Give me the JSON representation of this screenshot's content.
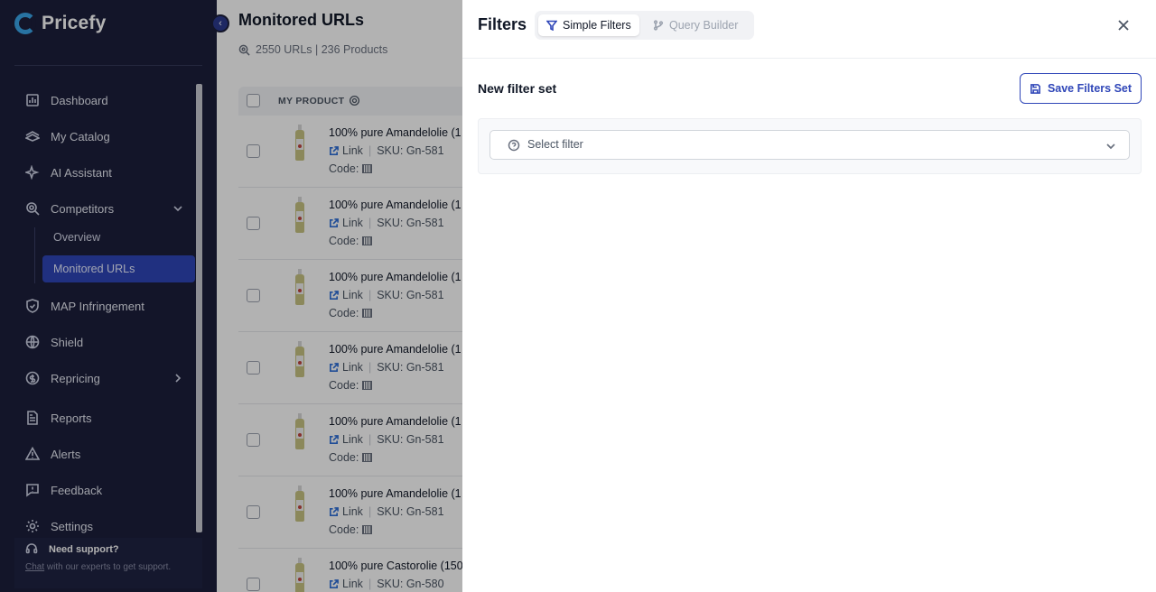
{
  "brand": {
    "name": "Pricefy",
    "accent": "#2f46b8",
    "sidebar_bg": "#1c1f3b"
  },
  "sidebar": {
    "items": [
      {
        "label": "Dashboard",
        "icon": "dashboard-icon"
      },
      {
        "label": "My Catalog",
        "icon": "catalog-icon"
      },
      {
        "label": "AI Assistant",
        "icon": "sparkle-icon"
      },
      {
        "label": "Competitors",
        "icon": "competitors-icon",
        "expanded": true
      },
      {
        "label": "MAP Infringement",
        "icon": "shield-check-icon"
      },
      {
        "label": "Shield",
        "icon": "globe-icon"
      },
      {
        "label": "Repricing",
        "icon": "repricing-icon"
      },
      {
        "label": "Reports",
        "icon": "report-icon"
      },
      {
        "label": "Alerts",
        "icon": "alert-icon"
      },
      {
        "label": "Feedback",
        "icon": "feedback-icon"
      },
      {
        "label": "Settings",
        "icon": "gear-icon"
      }
    ],
    "competitors_sub": [
      {
        "label": "Overview",
        "active": false
      },
      {
        "label": "Monitored URLs",
        "active": true
      }
    ],
    "support": {
      "title": "Need support?",
      "link": "Chat",
      "text": " with our experts to get support."
    }
  },
  "main": {
    "title": "Monitored URLs",
    "summary": "2550 URLs | 236 Products",
    "table": {
      "column_header": "MY PRODUCT",
      "rows": [
        {
          "name": "100% pure Amandelolie (1",
          "link": "Link",
          "sku": "SKU: Gn-581",
          "code": "Code:"
        },
        {
          "name": "100% pure Amandelolie (1",
          "link": "Link",
          "sku": "SKU: Gn-581",
          "code": "Code:"
        },
        {
          "name": "100% pure Amandelolie (1",
          "link": "Link",
          "sku": "SKU: Gn-581",
          "code": "Code:"
        },
        {
          "name": "100% pure Amandelolie (1",
          "link": "Link",
          "sku": "SKU: Gn-581",
          "code": "Code:"
        },
        {
          "name": "100% pure Amandelolie (1",
          "link": "Link",
          "sku": "SKU: Gn-581",
          "code": "Code:"
        },
        {
          "name": "100% pure Amandelolie (1",
          "link": "Link",
          "sku": "SKU: Gn-581",
          "code": "Code:"
        },
        {
          "name": "100% pure Castorolie (150",
          "link": "Link",
          "sku": "SKU: Gn-580",
          "code": "Code:"
        }
      ]
    }
  },
  "filters_panel": {
    "title": "Filters",
    "tabs": [
      {
        "label": "Simple Filters",
        "active": true
      },
      {
        "label": "Query Builder",
        "active": false
      }
    ],
    "set_title": "New filter set",
    "save_button": "Save Filters Set",
    "select_placeholder": "Select filter"
  }
}
